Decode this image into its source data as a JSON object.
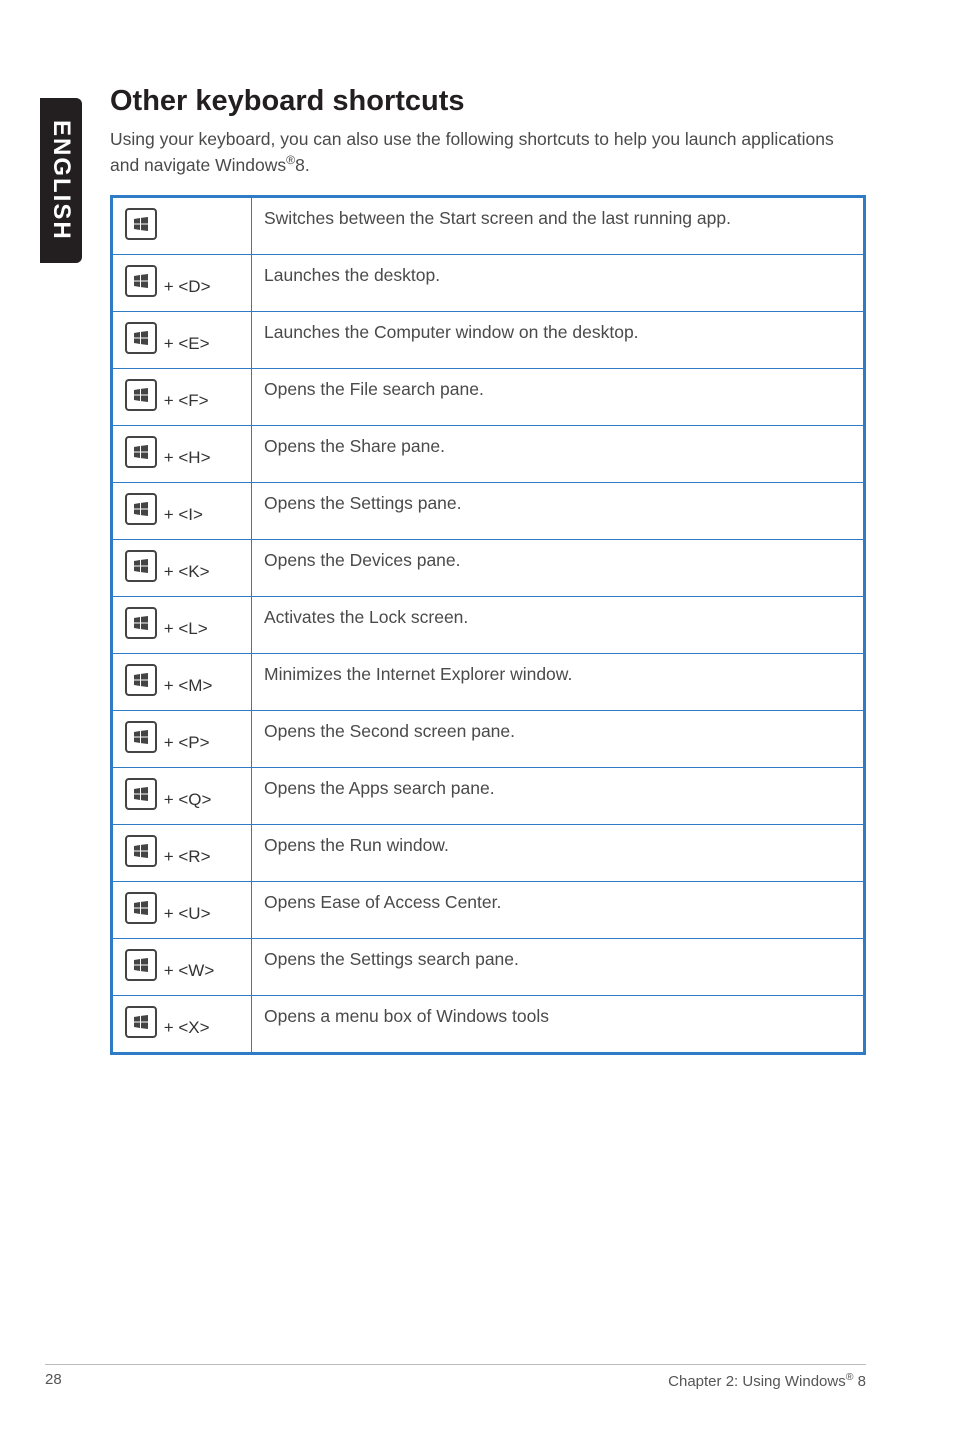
{
  "language_tab": "ENGLISH",
  "heading": "Other keyboard shortcuts",
  "intro": {
    "before": "Using your keyboard, you can also use the following shortcuts to help you launch applications and navigate Windows",
    "sup": "®",
    "after": "8."
  },
  "rows": [
    {
      "key_suffix": "",
      "desc": "Switches between the Start screen and the last running app.",
      "cls": "med"
    },
    {
      "key_suffix": " + <D>",
      "desc": "Launches the desktop.",
      "cls": "med"
    },
    {
      "key_suffix": " + <E>",
      "desc": "Launches the Computer window on the desktop.",
      "cls": "tall"
    },
    {
      "key_suffix": " + <F>",
      "desc": "Opens the File search pane.",
      "cls": "med"
    },
    {
      "key_suffix": " + <H>",
      "desc": "Opens the Share pane.",
      "cls": ""
    },
    {
      "key_suffix": " + <I>",
      "desc": "Opens the Settings pane.",
      "cls": "med"
    },
    {
      "key_suffix": " + <K>",
      "desc": "Opens the Devices pane.",
      "cls": "med"
    },
    {
      "key_suffix": " + <L>",
      "desc": "Activates the Lock screen.",
      "cls": "med"
    },
    {
      "key_suffix": " + <M>",
      "desc": "Minimizes the Internet Explorer window.",
      "cls": "med"
    },
    {
      "key_suffix": " + <P>",
      "desc": "Opens the Second screen pane.",
      "cls": "med"
    },
    {
      "key_suffix": " + <Q>",
      "desc": "Opens the Apps search pane.",
      "cls": "tall"
    },
    {
      "key_suffix": " + <R>",
      "desc": "Opens the Run window.",
      "cls": "med"
    },
    {
      "key_suffix": " + <U>",
      "desc": "Opens Ease of Access Center.",
      "cls": "med"
    },
    {
      "key_suffix": " + <W>",
      "desc": "Opens the Settings search pane.",
      "cls": "med"
    },
    {
      "key_suffix": " + <X>",
      "desc": "Opens a menu box of Windows tools",
      "cls": "med"
    }
  ],
  "footer": {
    "page_number": "28",
    "chapter_before": "Chapter 2: Using Windows",
    "chapter_sup": "®",
    "chapter_after": " 8"
  }
}
